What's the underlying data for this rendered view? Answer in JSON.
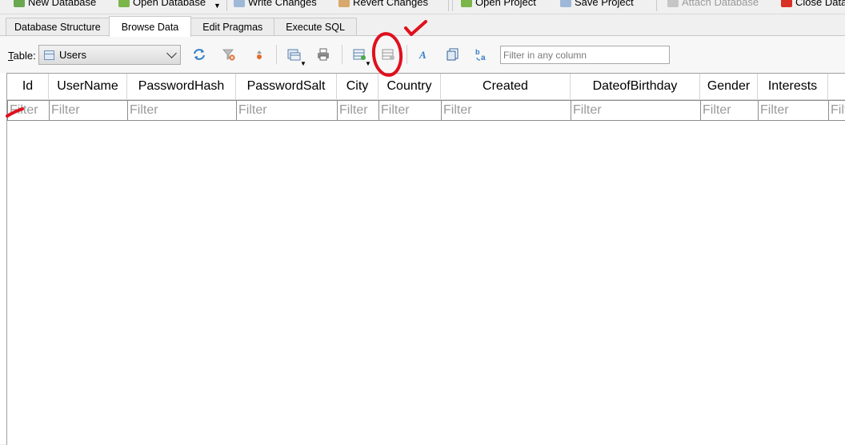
{
  "main_toolbar": {
    "items": [
      {
        "label": "New Database",
        "icon": "new-database-icon"
      },
      {
        "label": "Open Database",
        "icon": "open-database-icon"
      },
      {
        "label": "Write Changes",
        "icon": "write-changes-icon"
      },
      {
        "label": "Revert Changes",
        "icon": "revert-changes-icon"
      },
      {
        "label": "Open Project",
        "icon": "open-project-icon"
      },
      {
        "label": "Save Project",
        "icon": "save-project-icon"
      },
      {
        "label": "Attach Database",
        "icon": "attach-database-icon"
      },
      {
        "label": "Close Database",
        "icon": "close-database-icon"
      }
    ]
  },
  "tabs": [
    {
      "label": "Database Structure",
      "active": false
    },
    {
      "label": "Browse Data",
      "active": true
    },
    {
      "label": "Edit Pragmas",
      "active": false
    },
    {
      "label": "Execute SQL",
      "active": false
    }
  ],
  "browse": {
    "table_label_prefix": "T",
    "table_label_rest": "able:",
    "table_selected": "Users",
    "filter_any_placeholder": "Filter in any column"
  },
  "grid": {
    "columns": [
      "Id",
      "UserName",
      "PasswordHash",
      "PasswordSalt",
      "City",
      "Country",
      "Created",
      "DateofBirthday",
      "Gender",
      "Interests"
    ],
    "filter_placeholder": "Filter",
    "rows": []
  },
  "colors": {
    "annotation_red": "#e0101e",
    "toolbar_bg": "#f0f0f0",
    "grid_border": "#a0a0a0"
  }
}
